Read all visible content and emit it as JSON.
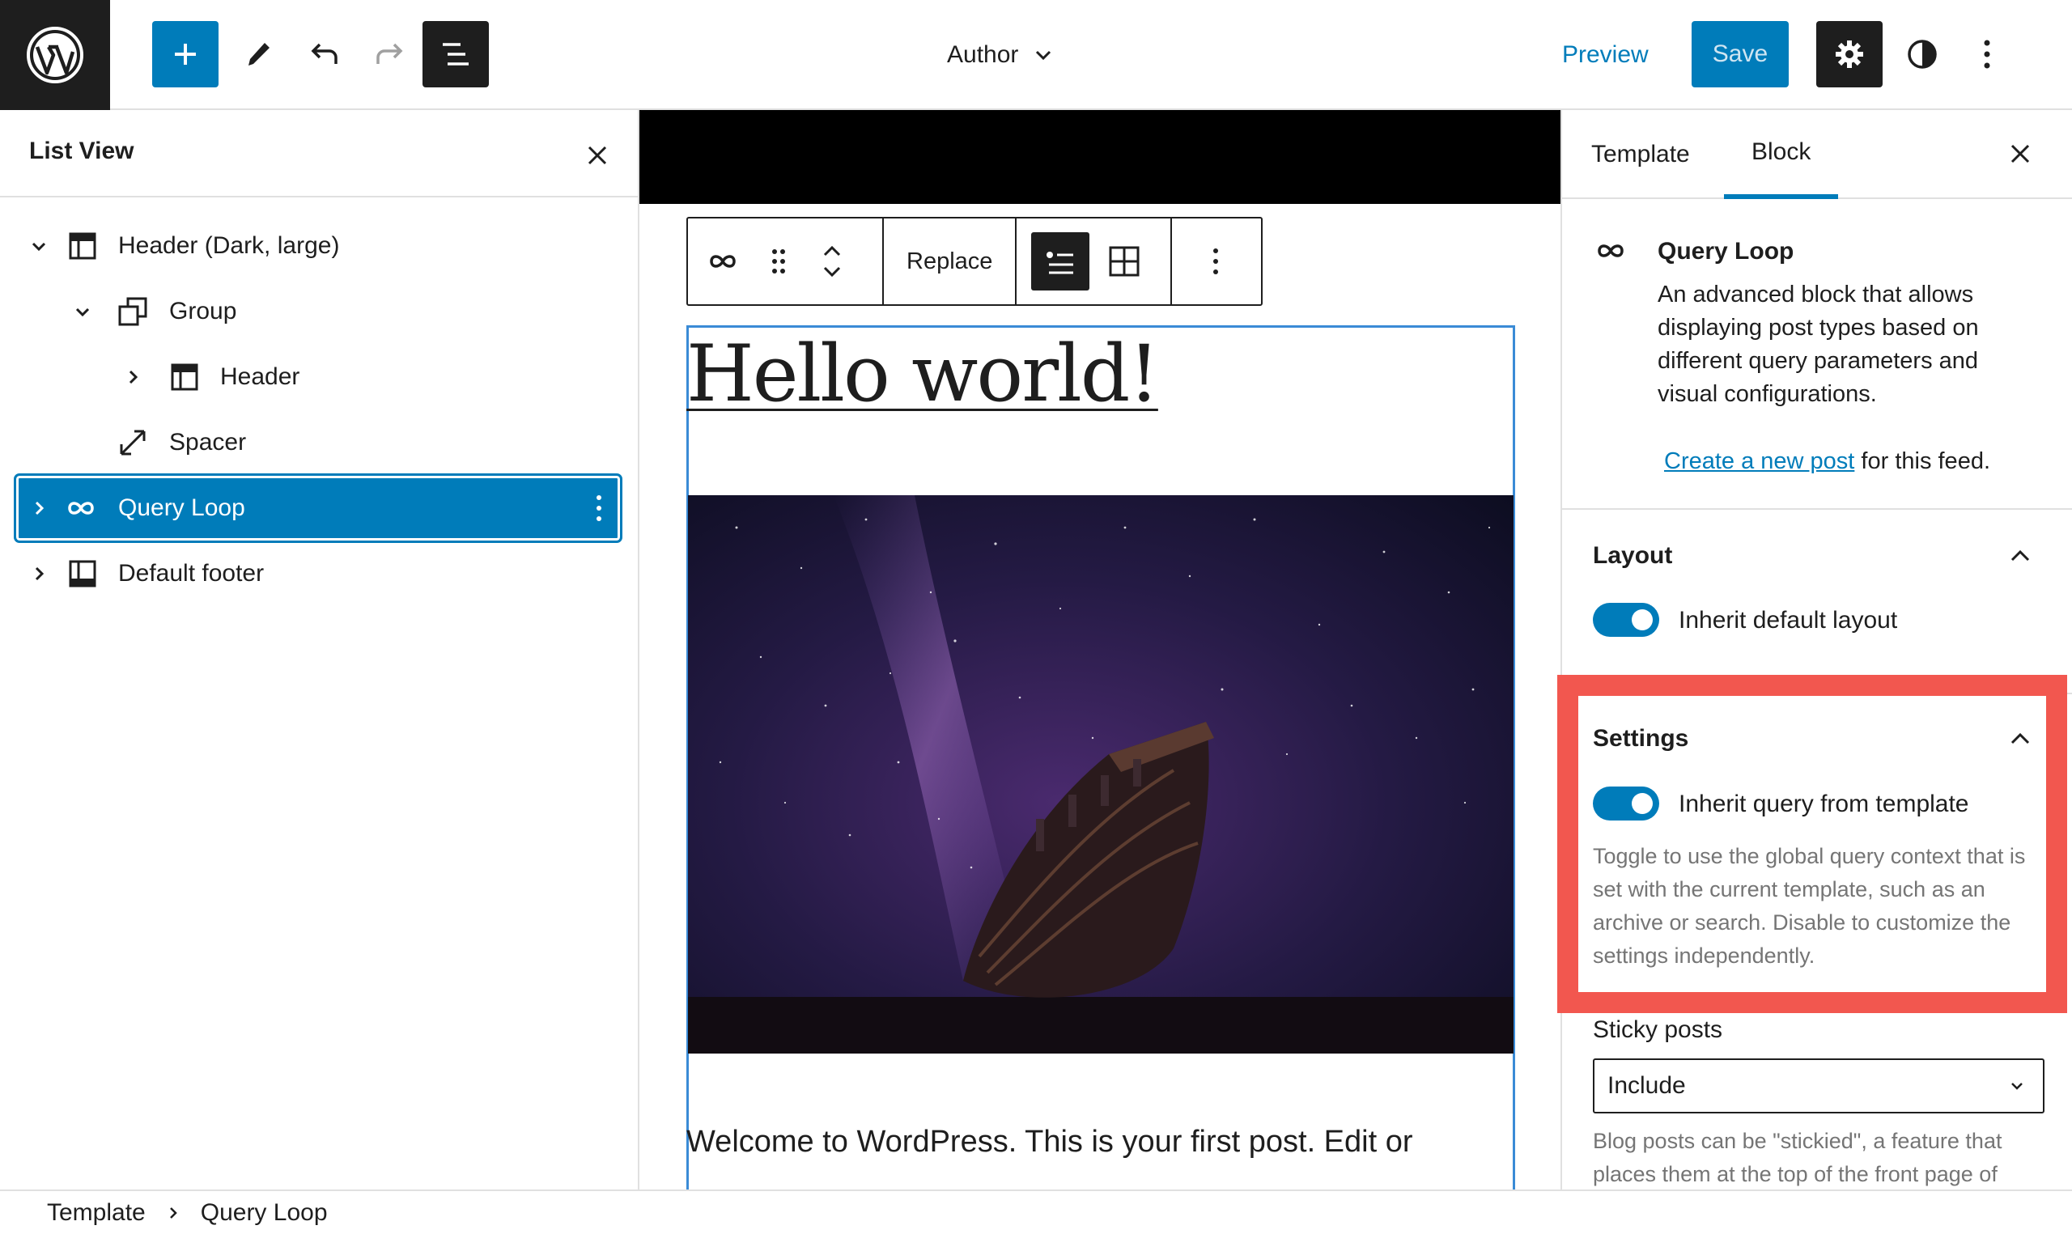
{
  "topbar": {
    "document_title": "Author",
    "preview_label": "Preview",
    "save_label": "Save"
  },
  "list_view": {
    "title": "List View",
    "items": [
      {
        "label": "Header (Dark, large)",
        "icon": "template-part-icon",
        "expanded": true
      },
      {
        "label": "Group",
        "icon": "group-icon",
        "expanded": true
      },
      {
        "label": "Header",
        "icon": "template-part-icon",
        "expanded": false
      },
      {
        "label": "Spacer",
        "icon": "resize-icon"
      },
      {
        "label": "Query Loop",
        "icon": "loop-icon",
        "expanded": false,
        "selected": true
      },
      {
        "label": "Default footer",
        "icon": "footer-icon",
        "expanded": false
      }
    ]
  },
  "canvas": {
    "toolbar_replace_label": "Replace",
    "post_title": "Hello world!",
    "post_excerpt": "Welcome to WordPress. This is your first post. Edit or"
  },
  "sidebar": {
    "tabs": [
      "Template",
      "Block"
    ],
    "active_tab": "Block",
    "block": {
      "title": "Query Loop",
      "description": "An advanced block that allows displaying post types based on different query parameters and visual configurations.",
      "create_link": "Create a new post",
      "create_suffix": " for this feed."
    },
    "layout": {
      "title": "Layout",
      "toggle_label": "Inherit default layout",
      "toggle_on": true
    },
    "settings": {
      "title": "Settings",
      "toggle_label": "Inherit query from template",
      "toggle_on": true,
      "help": "Toggle to use the global query context that is set with the current template, such as an archive or search. Disable to customize the settings independently."
    },
    "sticky": {
      "label": "Sticky posts",
      "value": "Include",
      "help": "Blog posts can be \"stickied\", a feature that places them at the top of the front page of"
    }
  },
  "breadcrumb": [
    "Template",
    "Query Loop"
  ],
  "colors": {
    "accent": "#007cba",
    "highlight": "#f2574f",
    "dark": "#1e1e1e"
  }
}
